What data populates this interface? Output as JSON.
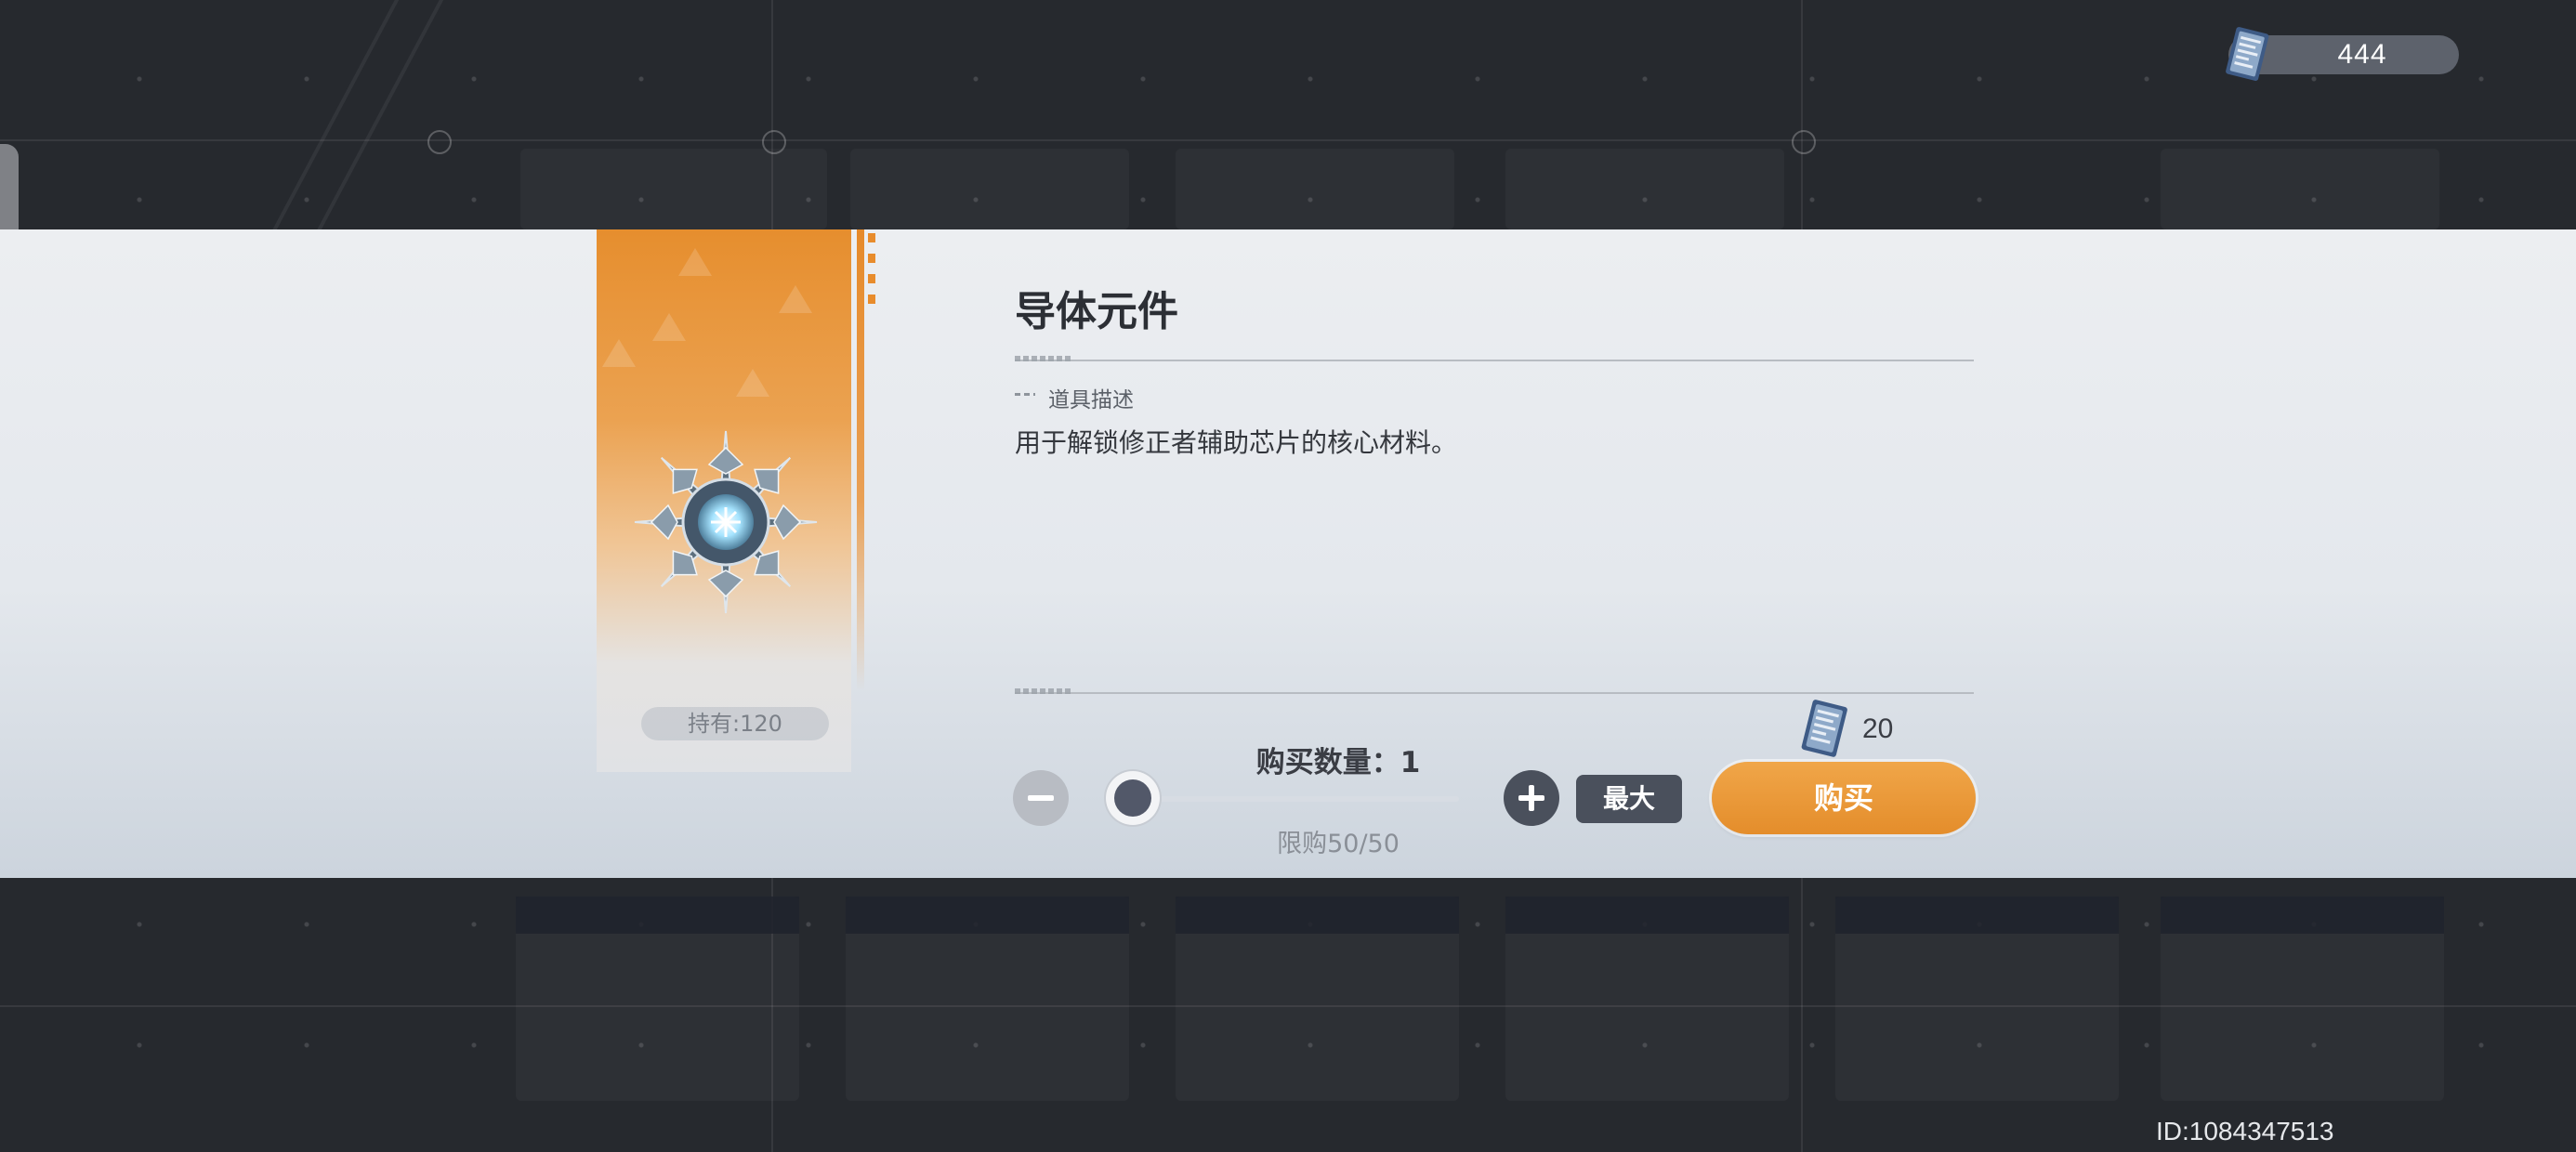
{
  "currency": {
    "icon": "ticket-icon",
    "amount": "444"
  },
  "item": {
    "name": "导体元件",
    "owned": "持有:120",
    "icon": "snowflake-crystal-icon",
    "description_title": "道具描述",
    "description": "用于解锁修正者辅助芯片的核心材料。"
  },
  "purchase": {
    "quantity_label": "购买数量：",
    "quantity": "1",
    "limit": "限购50/50",
    "max_label": "最大",
    "price": "20",
    "price_icon": "ticket-icon",
    "buy_label": "购买",
    "slider_fraction": 0
  },
  "footer": {
    "player_id": "ID:1084347513"
  },
  "colors": {
    "accent_orange": "#e68e2e",
    "button_dark": "#4a505c",
    "background": "#26292e"
  }
}
